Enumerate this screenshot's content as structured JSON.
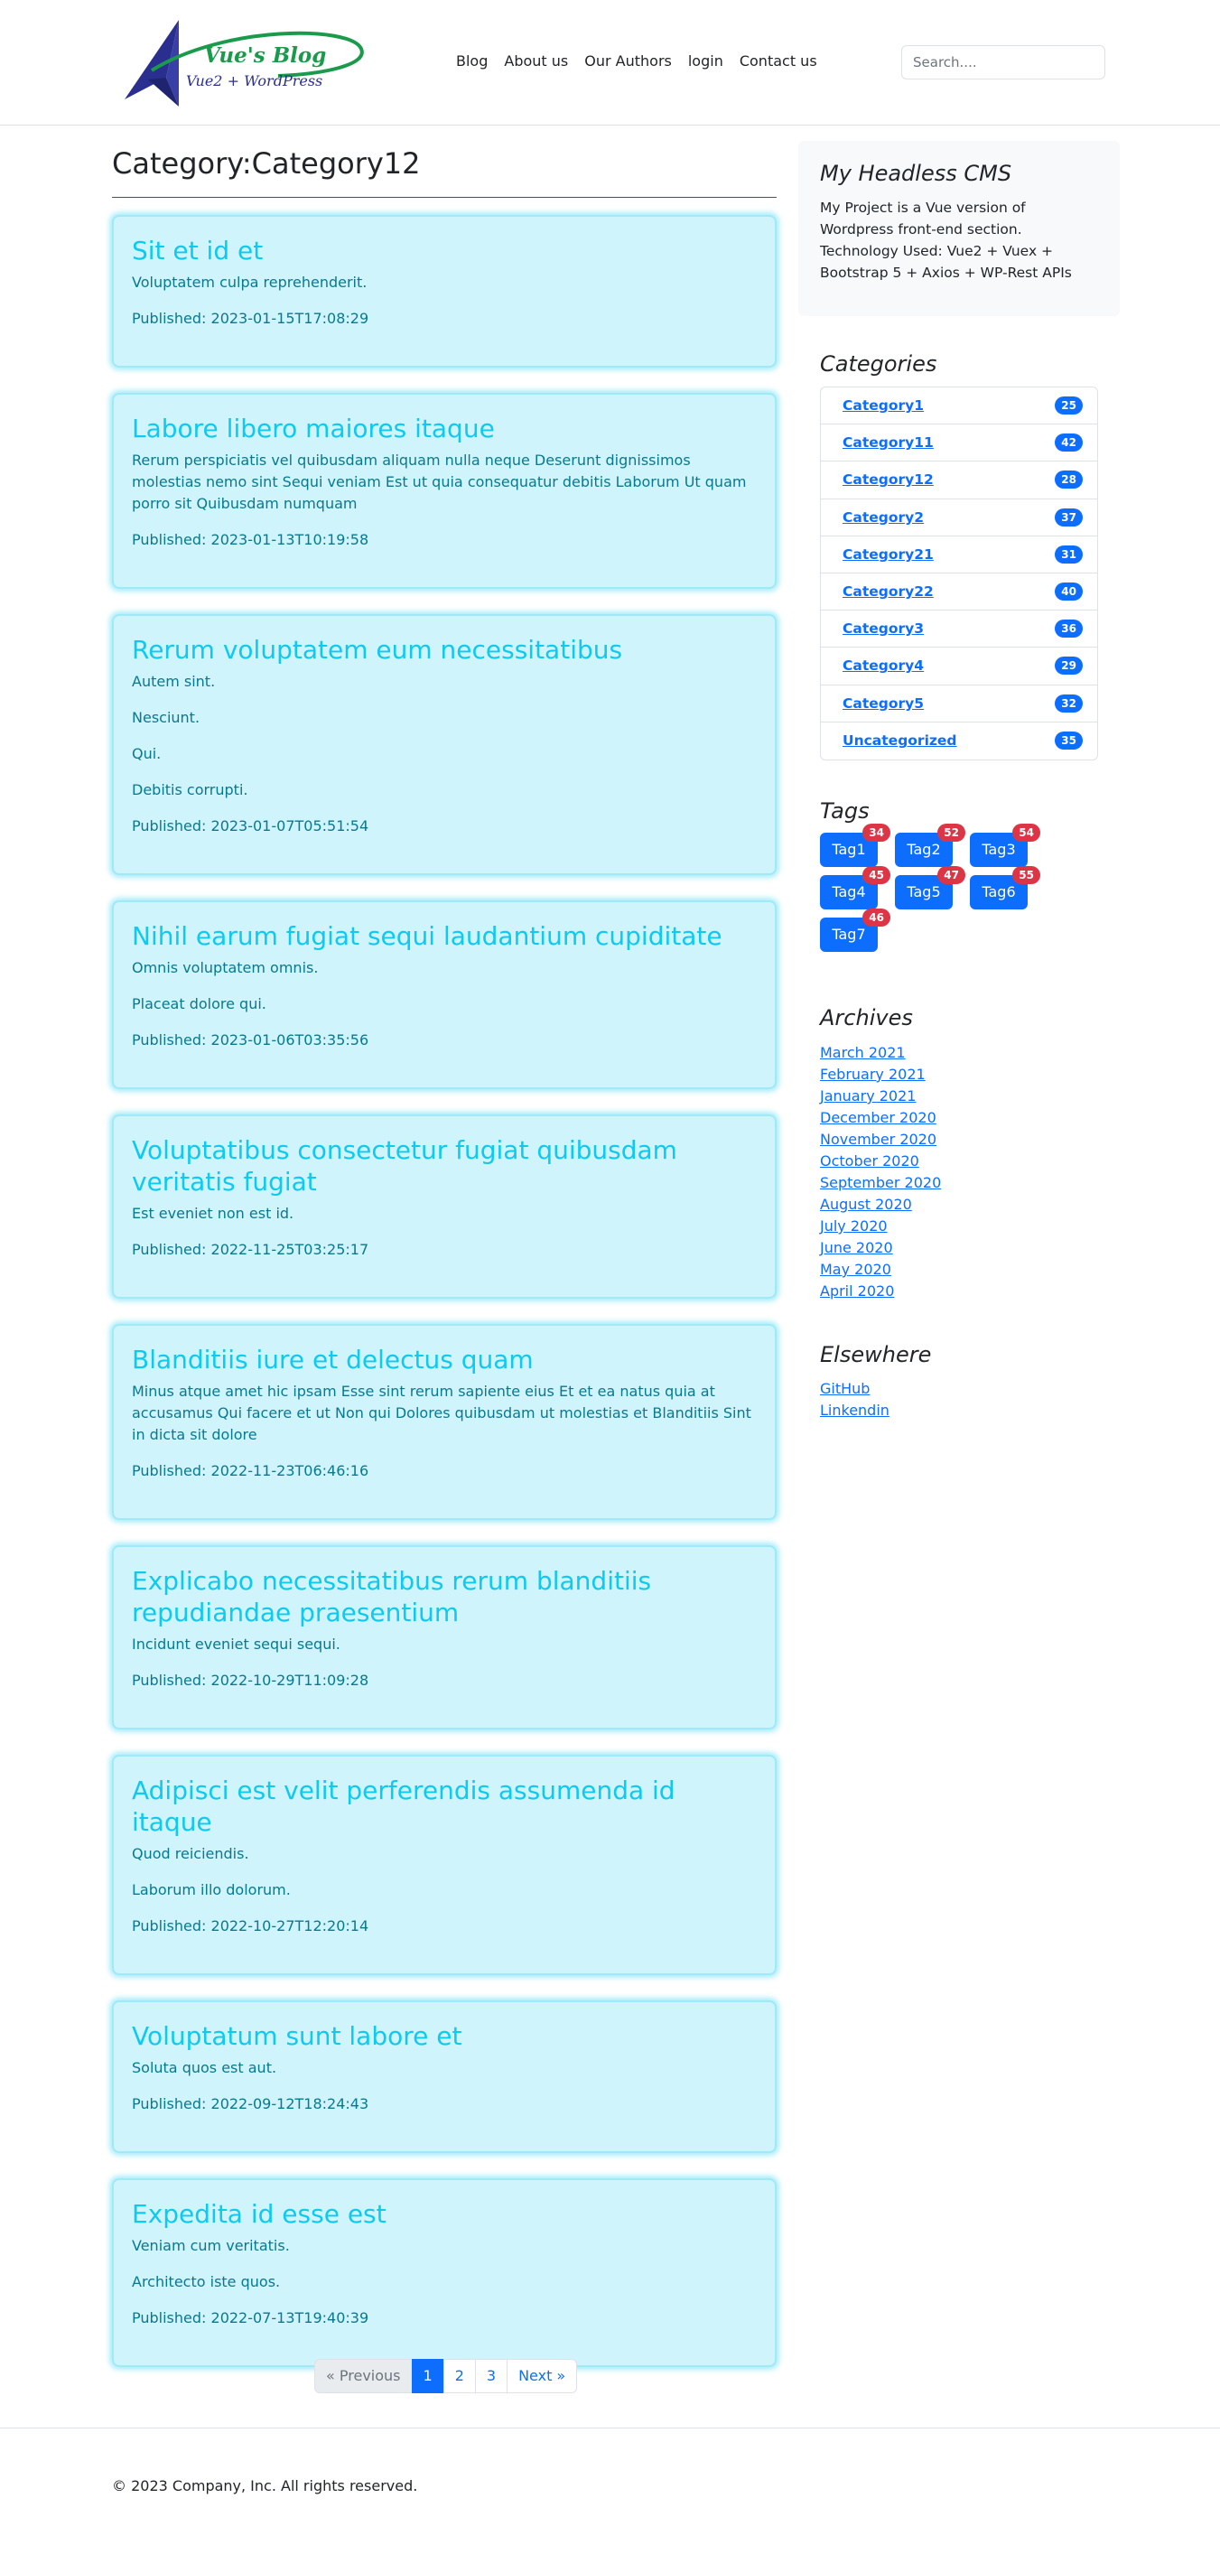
{
  "header": {
    "logo": {
      "title": "Vue's Blog",
      "subtitle": "Vue2 + WordPress"
    },
    "nav": [
      "Blog",
      "About us",
      "Our Authors",
      "login",
      "Contact us"
    ],
    "search_placeholder": "Search...."
  },
  "main": {
    "title": "Category:Category12",
    "posts": [
      {
        "title": "Sit et id et",
        "paragraphs": [
          "Voluptatem culpa reprehenderit."
        ],
        "published": "Published: 2023-01-15T17:08:29"
      },
      {
        "title": "Labore libero maiores itaque",
        "paragraphs": [
          "Rerum perspiciatis vel quibusdam aliquam nulla neque Deserunt dignissimos molestias nemo sint Sequi veniam Est ut quia consequatur debitis Laborum Ut quam porro sit Quibusdam numquam"
        ],
        "published": "Published: 2023-01-13T10:19:58"
      },
      {
        "title": "Rerum voluptatem eum necessitatibus",
        "paragraphs": [
          "Autem sint.",
          "Nesciunt.",
          "Qui.",
          "Debitis corrupti."
        ],
        "published": "Published: 2023-01-07T05:51:54"
      },
      {
        "title": "Nihil earum fugiat sequi laudantium cupiditate",
        "paragraphs": [
          "Omnis voluptatem omnis.",
          "Placeat dolore qui."
        ],
        "published": "Published: 2023-01-06T03:35:56"
      },
      {
        "title": "Voluptatibus consectetur fugiat quibusdam veritatis fugiat",
        "paragraphs": [
          "Est eveniet non est id."
        ],
        "published": "Published: 2022-11-25T03:25:17"
      },
      {
        "title": "Blanditiis iure et delectus quam",
        "paragraphs": [
          "Minus atque amet hic ipsam Esse sint rerum sapiente eius Et et ea natus quia at accusamus Qui facere et ut Non qui Dolores quibusdam ut molestias et Blanditiis Sint in dicta sit dolore"
        ],
        "published": "Published: 2022-11-23T06:46:16"
      },
      {
        "title": "Explicabo necessitatibus rerum blanditiis repudiandae praesentium",
        "paragraphs": [
          "Incidunt eveniet sequi sequi."
        ],
        "published": "Published: 2022-10-29T11:09:28"
      },
      {
        "title": "Adipisci est velit perferendis assumenda id itaque",
        "paragraphs": [
          "Quod reiciendis.",
          "Laborum illo dolorum."
        ],
        "published": "Published: 2022-10-27T12:20:14"
      },
      {
        "title": "Voluptatum sunt labore et",
        "paragraphs": [
          "Soluta quos est aut."
        ],
        "published": "Published: 2022-09-12T18:24:43"
      },
      {
        "title": "Expedita id esse est",
        "paragraphs": [
          "Veniam cum veritatis.",
          "Architecto iste quos."
        ],
        "published": "Published: 2022-07-13T19:40:39"
      }
    ],
    "pagination": {
      "previous": "« Previous",
      "pages": [
        "1",
        "2",
        "3"
      ],
      "active": "1",
      "next": "Next »"
    }
  },
  "sidebar": {
    "about": {
      "title": "My Headless CMS",
      "text": "My Project is a Vue version of Wordpress front-end section. Technology Used: Vue2 + Vuex + Bootstrap 5 + Axios + WP-Rest APIs"
    },
    "categories": {
      "title": "Categories",
      "items": [
        {
          "label": "Category1",
          "count": "25"
        },
        {
          "label": "Category11",
          "count": "42"
        },
        {
          "label": "Category12",
          "count": "28"
        },
        {
          "label": "Category2",
          "count": "37"
        },
        {
          "label": "Category21",
          "count": "31"
        },
        {
          "label": "Category22",
          "count": "40"
        },
        {
          "label": "Category3",
          "count": "36"
        },
        {
          "label": "Category4",
          "count": "29"
        },
        {
          "label": "Category5",
          "count": "32"
        },
        {
          "label": "Uncategorized",
          "count": "35"
        }
      ]
    },
    "tags": {
      "title": "Tags",
      "items": [
        {
          "label": "Tag1",
          "count": "34"
        },
        {
          "label": "Tag2",
          "count": "52"
        },
        {
          "label": "Tag3",
          "count": "54"
        },
        {
          "label": "Tag4",
          "count": "45"
        },
        {
          "label": "Tag5",
          "count": "47"
        },
        {
          "label": "Tag6",
          "count": "55"
        },
        {
          "label": "Tag7",
          "count": "46"
        }
      ]
    },
    "archives": {
      "title": "Archives",
      "items": [
        "March 2021",
        "February 2021",
        "January 2021",
        "December 2020",
        "November 2020",
        "October 2020",
        "September 2020",
        "August 2020",
        "July 2020",
        "June 2020",
        "May 2020",
        "April 2020"
      ]
    },
    "elsewhere": {
      "title": "Elsewhere",
      "items": [
        "GitHub",
        "Linkendin"
      ]
    }
  },
  "footer": {
    "copyright": "© 2023 Company, Inc. All rights reserved."
  },
  "colors": {
    "primary": "#0d6efd",
    "info": "#0dcaf0",
    "info_bg": "#cff4fc",
    "info_text": "#087990",
    "danger": "#dc3545"
  }
}
